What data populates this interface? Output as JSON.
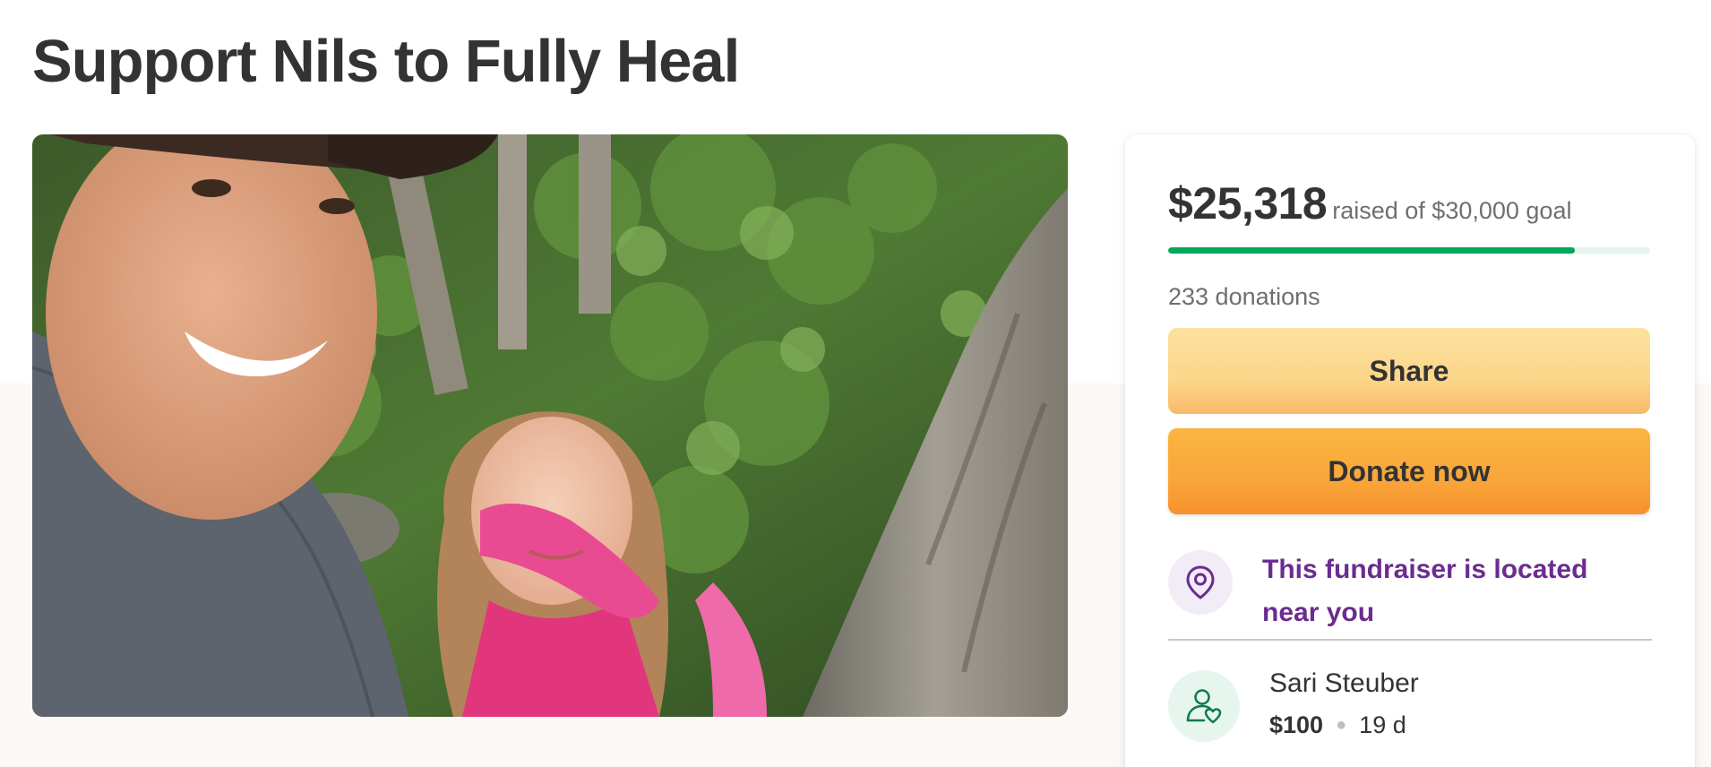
{
  "page": {
    "title": "Support Nils to Fully Heal"
  },
  "hero": {
    "alt": "Photo of a smiling man in a hat with a girl holding a pink stuffed snake in a forest"
  },
  "donation_card": {
    "amount_raised": "$25,318",
    "goal_text": "raised of $30,000 goal",
    "progress_fraction": 0.844,
    "donations_count": "233 donations",
    "share_label": "Share",
    "donate_label": "Donate now",
    "location_text": "This fundraiser is located near you",
    "recent_donation": {
      "name": "Sari Steuber",
      "amount": "$100",
      "time": "19 d"
    }
  },
  "colors": {
    "progress": "#02a95c",
    "progress_track": "#e3f4ec",
    "location_purple": "#6b2c8f",
    "donate_orange": "#f9a63a",
    "share_yellow": "#fcd68a"
  },
  "icons": {
    "location": "map-pin-icon",
    "donor": "person-heart-icon"
  }
}
